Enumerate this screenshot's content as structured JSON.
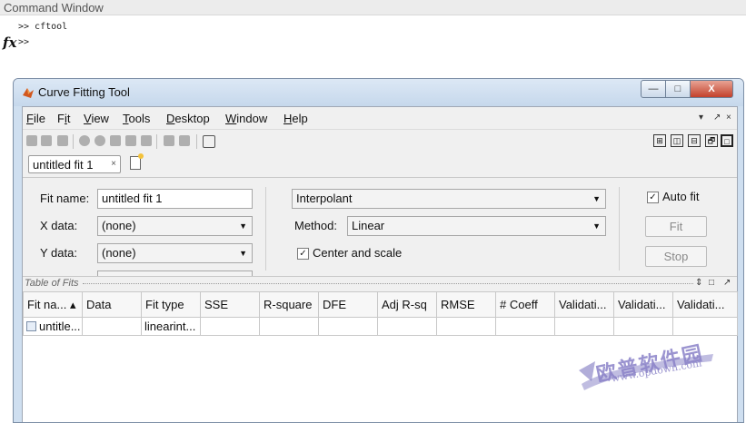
{
  "command_window": {
    "title": "Command Window",
    "history_line": ">> cftool",
    "prompt": ">>",
    "fx_label": "fx"
  },
  "window": {
    "title": "Curve Fitting Tool",
    "min": "—",
    "max": "□",
    "close": "X"
  },
  "menu": {
    "file": {
      "u": "F",
      "rest": "ile"
    },
    "fit": {
      "pre": "F",
      "u": "i",
      "rest": "t"
    },
    "view": {
      "u": "V",
      "rest": "iew"
    },
    "tools": {
      "u": "T",
      "rest": "ools"
    },
    "desktop": {
      "u": "D",
      "rest": "esktop"
    },
    "window": {
      "u": "W",
      "rest": "indow"
    },
    "help": {
      "u": "H",
      "rest": "elp"
    },
    "dock_controls": [
      "▾",
      "↗",
      "×"
    ]
  },
  "tab": {
    "label": "untitled fit 1",
    "close": "×"
  },
  "settings": {
    "fit_name_label": "Fit name:",
    "fit_name_value": "untitled fit 1",
    "x_data_label": "X data:",
    "x_data_value": "(none)",
    "y_data_label": "Y data:",
    "y_data_value": "(none)",
    "fit_type_value": "Interpolant",
    "method_label": "Method:",
    "method_value": "Linear",
    "center_scale_checked": "✓",
    "center_scale_label": "Center and scale",
    "auto_fit_checked": "✓",
    "auto_fit_label": "Auto fit",
    "fit_button": "Fit",
    "stop_button": "Stop"
  },
  "table_of_fits": {
    "title": "Table of Fits",
    "controls": [
      "⇕",
      "□",
      "↗"
    ],
    "columns": [
      "Fit na... ▴",
      "Data",
      "Fit type",
      "SSE",
      "R-square",
      "DFE",
      "Adj R-sq",
      "RMSE",
      "# Coeff",
      "Validati...",
      "Validati...",
      "Validati..."
    ],
    "rows": [
      [
        "untitle...",
        "",
        "linearint...",
        "",
        "",
        "",
        "",
        "",
        "",
        "",
        "",
        ""
      ]
    ]
  },
  "watermark": {
    "text": "欧普软件园",
    "url": "www.opdown.com"
  }
}
